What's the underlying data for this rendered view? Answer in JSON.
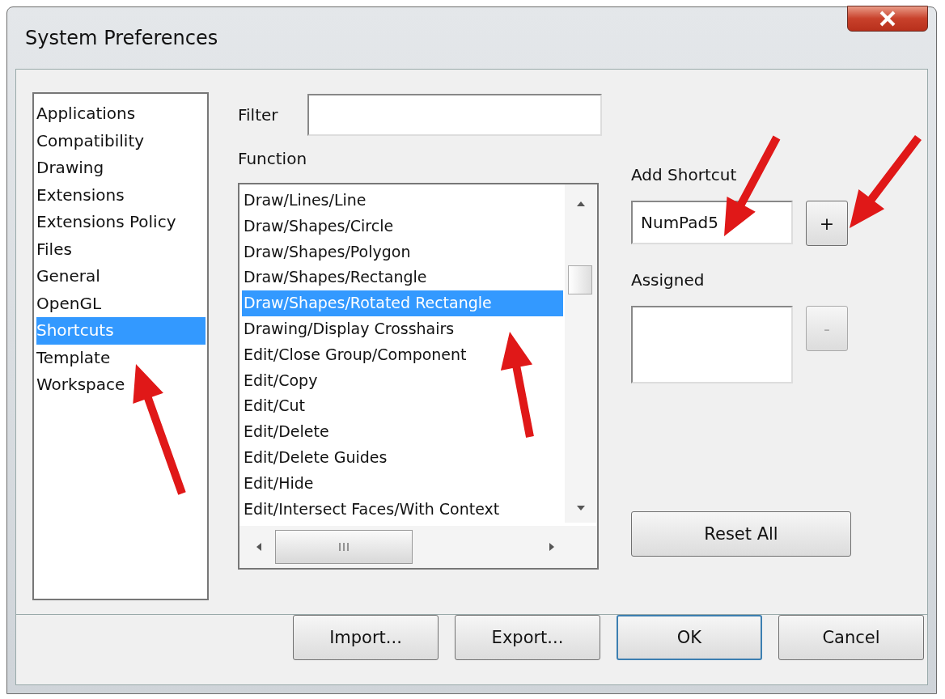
{
  "window": {
    "title": "System Preferences"
  },
  "categories": [
    {
      "label": "Applications",
      "selected": false
    },
    {
      "label": "Compatibility",
      "selected": false
    },
    {
      "label": "Drawing",
      "selected": false
    },
    {
      "label": "Extensions",
      "selected": false
    },
    {
      "label": "Extensions Policy",
      "selected": false
    },
    {
      "label": "Files",
      "selected": false
    },
    {
      "label": "General",
      "selected": false
    },
    {
      "label": "OpenGL",
      "selected": false
    },
    {
      "label": "Shortcuts",
      "selected": true
    },
    {
      "label": "Template",
      "selected": false
    },
    {
      "label": "Workspace",
      "selected": false
    }
  ],
  "filter": {
    "label": "Filter"
  },
  "function": {
    "label": "Function",
    "items": [
      {
        "label": "Draw/Lines/Line",
        "selected": false
      },
      {
        "label": "Draw/Shapes/Circle",
        "selected": false
      },
      {
        "label": "Draw/Shapes/Polygon",
        "selected": false
      },
      {
        "label": "Draw/Shapes/Rectangle",
        "selected": false
      },
      {
        "label": "Draw/Shapes/Rotated Rectangle",
        "selected": true
      },
      {
        "label": "Drawing/Display Crosshairs",
        "selected": false
      },
      {
        "label": "Edit/Close Group/Component",
        "selected": false
      },
      {
        "label": "Edit/Copy",
        "selected": false
      },
      {
        "label": "Edit/Cut",
        "selected": false
      },
      {
        "label": "Edit/Delete",
        "selected": false
      },
      {
        "label": "Edit/Delete Guides",
        "selected": false
      },
      {
        "label": "Edit/Hide",
        "selected": false
      },
      {
        "label": "Edit/Intersect Faces/With Context",
        "selected": false
      }
    ]
  },
  "add_shortcut": {
    "label": "Add Shortcut",
    "value": "NumPad5",
    "button": {
      "label": "+",
      "disabled": false
    }
  },
  "assigned": {
    "label": "Assigned",
    "button": {
      "label": "-",
      "disabled": true
    }
  },
  "reset_button": "Reset All",
  "buttons": [
    {
      "label": "Import...",
      "default": false
    },
    {
      "label": "Export...",
      "default": false
    },
    {
      "label": "OK",
      "default": true
    },
    {
      "label": "Cancel",
      "default": false
    }
  ],
  "annotations": [
    {
      "kind": "arrow",
      "color": "#e01818"
    },
    {
      "kind": "arrow",
      "color": "#e01818"
    },
    {
      "kind": "arrow",
      "color": "#e01818"
    },
    {
      "kind": "arrow",
      "color": "#e01818"
    }
  ]
}
